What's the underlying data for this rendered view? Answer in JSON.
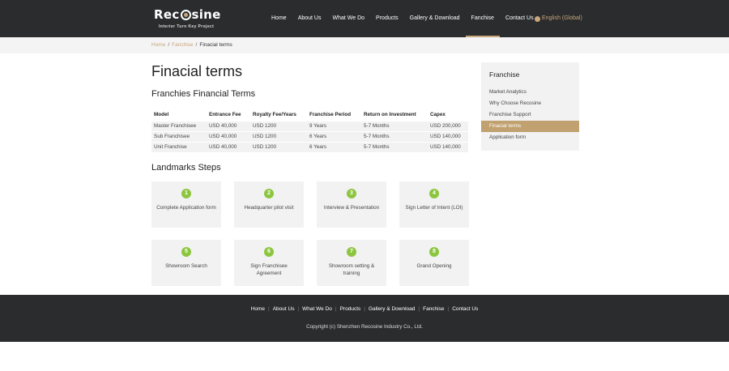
{
  "header": {
    "logo_main_before": "Rec",
    "logo_main_after": "sine",
    "logo_sub": "Interior Turn Key Project",
    "nav": [
      {
        "label": "Home"
      },
      {
        "label": "About Us"
      },
      {
        "label": "What We Do"
      },
      {
        "label": "Products"
      },
      {
        "label": "Gallery & Download"
      },
      {
        "label": "Fanchise",
        "active": true
      },
      {
        "label": "Contact Us"
      }
    ],
    "language": "English (Global)",
    "accent_color": "#c9a77c"
  },
  "breadcrumb": {
    "home": "Home",
    "parent": "Fanchise",
    "current": "Finacial terms",
    "separator": "/"
  },
  "main": {
    "title": "Finacial terms",
    "table_heading": "Franchies Financial Terms",
    "table": {
      "columns": [
        "Model",
        "Entrance Fee",
        "Royalty Fee/Years",
        "Franchise Period",
        "Return on Investment",
        "Capex"
      ],
      "rows": [
        [
          "Master Franchisee",
          "USD 40,000",
          "USD 1200",
          "9 Years",
          "5-7 Months",
          "USD 200,000"
        ],
        [
          "Sub Franchisee",
          "USD 40,000",
          "USD 1200",
          "6 Years",
          "5-7 Months",
          "USD 140,000"
        ],
        [
          "Unit Franchise",
          "USD 40,000",
          "USD 1200",
          "6 Years",
          "5-7 Months",
          "USD 140,000"
        ]
      ]
    },
    "steps_heading": "Landmarks Steps",
    "steps": [
      {
        "num": "1",
        "label": "Complete Application form"
      },
      {
        "num": "2",
        "label": "Headquarter pilot visit"
      },
      {
        "num": "3",
        "label": "Interview & Presentation"
      },
      {
        "num": "4",
        "label": "Sign Letter of Intent (LOI)"
      },
      {
        "num": "5",
        "label": "Showroom Search"
      },
      {
        "num": "6",
        "label": "Sign Franchisee Agreement"
      },
      {
        "num": "7",
        "label": "Showroom setting & training"
      },
      {
        "num": "8",
        "label": "Grand Opening"
      }
    ],
    "step_color": "#8cc63f"
  },
  "sidebar": {
    "title": "Franchise",
    "items": [
      {
        "label": "Market Analytics"
      },
      {
        "label": "Why Choose Recosine"
      },
      {
        "label": "Franchise Support"
      },
      {
        "label": "Finacial terms",
        "active": true
      },
      {
        "label": "Application form"
      }
    ]
  },
  "footer": {
    "links": [
      {
        "label": "Home"
      },
      {
        "label": "About Us"
      },
      {
        "label": "What We Do"
      },
      {
        "label": "Products"
      },
      {
        "label": "Gallery & Download"
      },
      {
        "label": "Fanchise"
      },
      {
        "label": "Contact Us"
      }
    ],
    "separator": "|",
    "copyright": "Copyright (c) Shenzhen Recosine Industry Co., Ltd."
  }
}
